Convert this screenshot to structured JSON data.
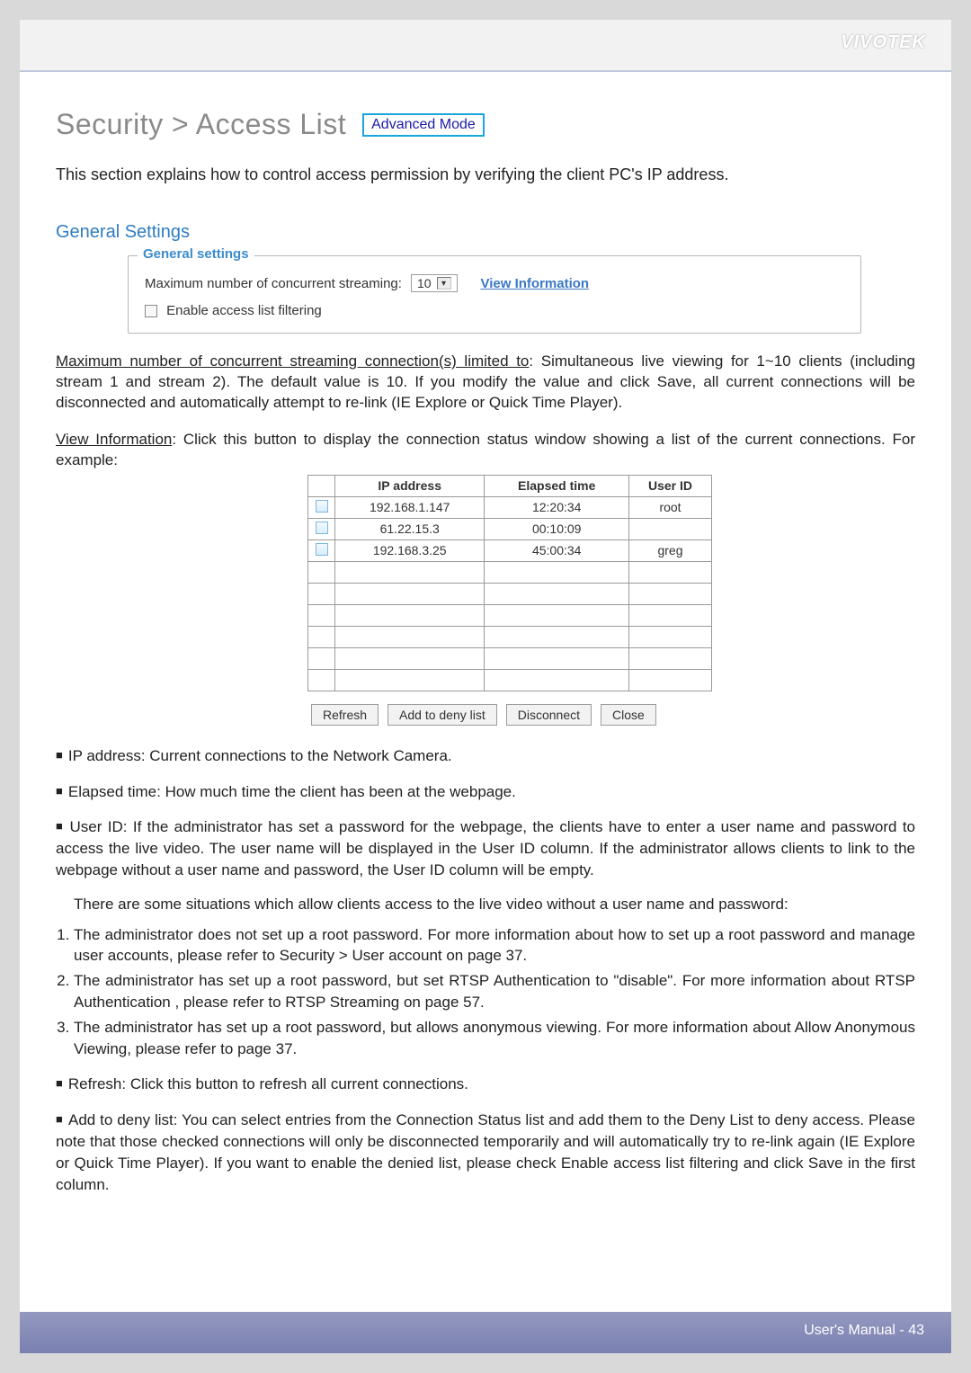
{
  "brand": "VIVOTEK",
  "title": "Security >  Access List",
  "badge": "Advanced Mode",
  "intro": "This section explains how to control access permission by verifying the client PC's IP address.",
  "general_heading": "General Settings",
  "fieldset": {
    "legend": "General settings",
    "max_label": "Maximum number of concurrent streaming:",
    "max_value": "10",
    "view_info": "View Information",
    "enable_label": "Enable access list filtering"
  },
  "para_max_label": "Maximum number of concurrent streaming connection(s) limited to",
  "para_max_body": ": Simultaneous live viewing for 1~10 clients (including stream 1 and stream 2). The default value is 10. If you modify the value and click Save, all current connections will be disconnected and automatically attempt to re-link (IE Explore or Quick Time Player).",
  "para_view_label": "View Information",
  "para_view_body": ": Click this button to display the connection status window showing a list of the current connections. For example:",
  "table": {
    "headers": [
      "IP address",
      "Elapsed time",
      "User ID"
    ],
    "rows": [
      {
        "check": true,
        "ip": "192.168.1.147",
        "time": "12:20:34",
        "uid": "root"
      },
      {
        "check": true,
        "ip": "61.22.15.3",
        "time": "00:10:09",
        "uid": ""
      },
      {
        "check": true,
        "ip": "192.168.3.25",
        "time": "45:00:34",
        "uid": "greg"
      },
      {
        "check": false,
        "ip": "",
        "time": "",
        "uid": ""
      },
      {
        "check": false,
        "ip": "",
        "time": "",
        "uid": ""
      },
      {
        "check": false,
        "ip": "",
        "time": "",
        "uid": ""
      },
      {
        "check": false,
        "ip": "",
        "time": "",
        "uid": ""
      },
      {
        "check": false,
        "ip": "",
        "time": "",
        "uid": ""
      },
      {
        "check": false,
        "ip": "",
        "time": "",
        "uid": ""
      }
    ]
  },
  "buttons": {
    "refresh": "Refresh",
    "add_deny": "Add to deny list",
    "disconnect": "Disconnect",
    "close": "Close"
  },
  "bullets": {
    "ip": "IP address: Current connections to the Network Camera.",
    "elapsed": "Elapsed time: How much time the client has been at the webpage.",
    "uid_intro": "User ID: If the administrator has set a password for the webpage, the clients have to enter a user name and password to access the live video. The user name will be displayed in the User ID column. If  the administrator allows clients to link to the webpage without a user name and password, the User ID column will be empty.",
    "uid_situations": "There are some situations which allow clients access to the live video without a user name and password:",
    "uid_s1": "The administrator does not set up a root password. For more information about how to set up a root password and manage user accounts, please refer to Security > User account on page 37.",
    "uid_s2": "The administrator has set up a root password, but set RTSP Authentication   to \"disable\". For more information about RTSP Authentication  , please refer to RTSP Streaming on page 57.",
    "uid_s3": "The administrator has set up a root password, but allows anonymous viewing. For more information about Allow Anonymous Viewing,     please refer to page 37.",
    "refresh": "Refresh: Click this button to refresh all current connections.",
    "add_deny": "Add to deny list: You can select entries from the Connection Status list and add them to the Deny List to deny access. Please note that those checked connections will only be disconnected temporarily and will automatically try to re-link again (IE Explore or Quick Time Player). If you want to enable the denied list, please check Enable access list filtering and click Save in the first column."
  },
  "footer": "User's Manual - 43"
}
